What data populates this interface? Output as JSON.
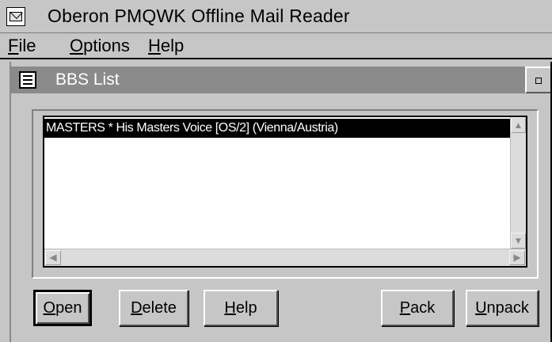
{
  "app": {
    "title": "Oberon PMQWK Offline Mail Reader"
  },
  "menu": {
    "items": [
      {
        "accel": "F",
        "rest": "ile"
      },
      {
        "accel": "O",
        "rest": "ptions"
      },
      {
        "accel": "H",
        "rest": "elp"
      }
    ]
  },
  "child_window": {
    "title": "BBS List"
  },
  "bbs_list": {
    "items": [
      {
        "text": "MASTERS  * His Masters Voice [OS/2] (Vienna/Austria)",
        "selected": true
      }
    ]
  },
  "buttons": [
    {
      "accel": "O",
      "rest": "pen"
    },
    {
      "accel": "D",
      "rest": "elete"
    },
    {
      "accel": "H",
      "rest": "elp"
    },
    {
      "accel": "P",
      "rest": "ack"
    },
    {
      "accel": "U",
      "rest": "npack"
    }
  ],
  "icons": {
    "app_icon": "mail-envelope-icon",
    "child_icon": "list-window-icon",
    "maximize": "maximize-icon",
    "scroll_up": "chevron-up-icon",
    "scroll_down": "chevron-down-icon",
    "scroll_left": "chevron-left-icon",
    "scroll_right": "chevron-right-icon"
  },
  "colors": {
    "face": "#c6c6c6",
    "inactive_title": "#8a8a8a",
    "selection": "#000000"
  }
}
